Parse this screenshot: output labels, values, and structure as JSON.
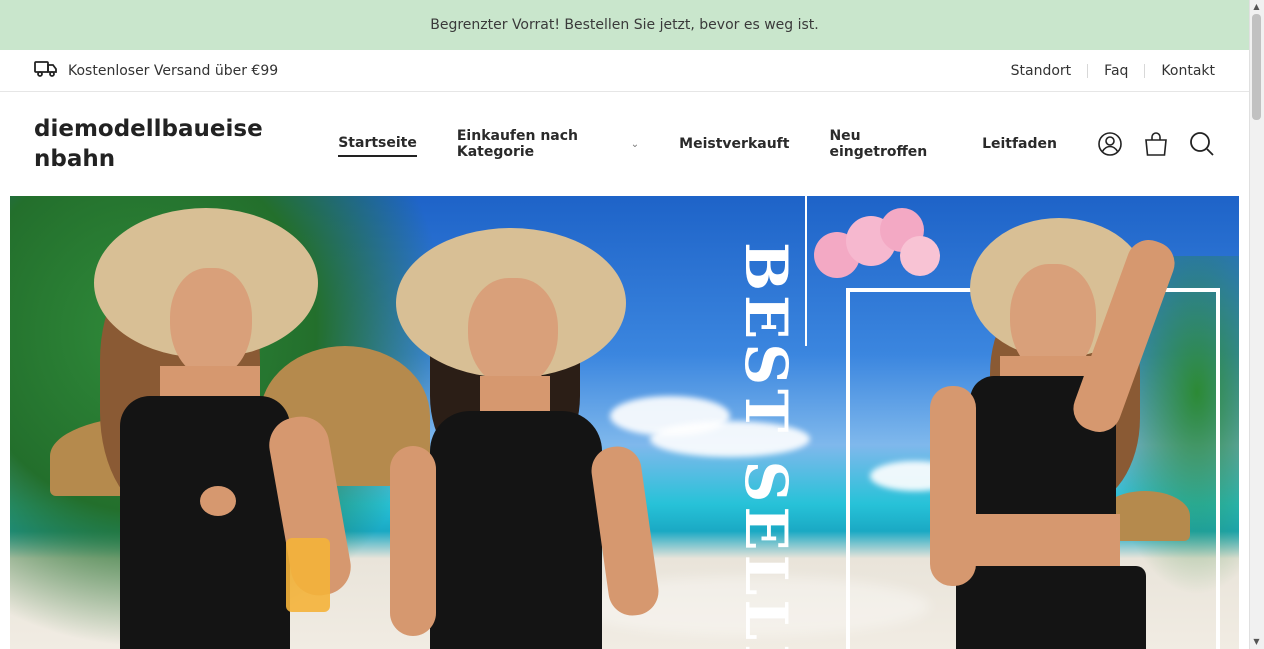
{
  "announcement": {
    "text": "Begrenzter Vorrat! Bestellen Sie jetzt, bevor es weg ist."
  },
  "utility": {
    "shipping_text": "Kostenloser Versand über €99",
    "links": [
      {
        "label": "Standort"
      },
      {
        "label": "Faq"
      },
      {
        "label": "Kontakt"
      }
    ]
  },
  "header": {
    "logo": "diemodellbaueisenbahn",
    "nav": [
      {
        "label": "Startseite",
        "active": true
      },
      {
        "label": "Einkaufen nach Kategorie",
        "dropdown": true
      },
      {
        "label": "Meistverkauft"
      },
      {
        "label": "Neu eingetroffen"
      },
      {
        "label": "Leitfaden"
      }
    ],
    "icons": [
      "account-icon",
      "cart-icon",
      "search-icon"
    ]
  },
  "hero": {
    "text": "BEST SELLE"
  },
  "colors": {
    "announcement_bg": "#c9e6cc",
    "text_primary": "#222222"
  }
}
